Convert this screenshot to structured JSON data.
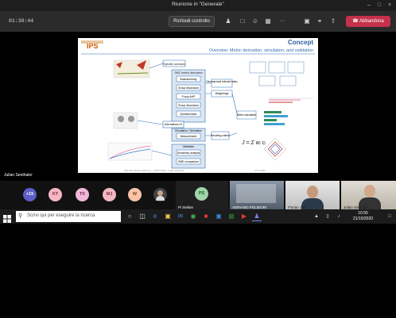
{
  "window": {
    "title": "Riunione in \"Generale\""
  },
  "toolbar": {
    "timer": "01:30:44",
    "request_control": "Richiedi controllo",
    "more": "···",
    "leave": "Abbandona"
  },
  "slide": {
    "logo": "IPS",
    "title": "Concept",
    "subtitle": "Overview: Metric derivation, simulation, and validation",
    "boxes": {
      "specific": "Specific scenario",
      "smc": "SMC metric derivation",
      "brainstorming": "Brainstorming",
      "group_discussion": "Group discussion",
      "fuzzy_ahp": "Fuzzy AHP",
      "group_discussion2": "Group discussion",
      "questionnaire": "Questionnaire",
      "decomposed": "Decomposed relevant tasks",
      "weightings": "Weightings",
      "metric_calc": "Metric calculation",
      "alternatives": "Alternatives IO",
      "simulation": "Simulation / Derivation",
      "measurement": "Measurement",
      "resulting": "Resulting criteria",
      "validation": "Validation",
      "sensitivity": "Sensitivity analysis",
      "sme_comparison": "SME comparison"
    },
    "formula": "J = Σ wᵢ cᵢ",
    "footer_left": "Multi-filer Mission Efficiency – AMIS4 2020 – Julian Seethaler",
    "footer_right": "07.11.2020"
  },
  "presenter": "Julian Seethaler",
  "participants": {
    "more": "+15",
    "avatars": [
      {
        "initials": "KT",
        "color": "#f4b6c2",
        "text": "#7a2e3f"
      },
      {
        "initials": "TK",
        "color": "#f0b8d8",
        "text": "#7a2e5c"
      },
      {
        "initials": "MJ",
        "color": "#f4b6c2",
        "text": "#7a2e3f"
      },
      {
        "initials": "W",
        "color": "#f9c3a8",
        "text": "#7a3e1c"
      }
    ],
    "ps": {
      "initials": "PS",
      "color": "#9fd5a8",
      "text": "#1d5a2a",
      "name": "Pi Stelian"
    },
    "tiles": [
      {
        "name": "ADRIANO POLIDORI"
      },
      {
        "name": "Florian Jae"
      },
      {
        "name": "Julian Seethaler"
      }
    ]
  },
  "taskbar": {
    "search_placeholder": "Scrivi qui per eseguire la ricerca",
    "time": "10:55",
    "date": "21/10/2020"
  },
  "colors": {
    "accent": "#c4314b",
    "box_blue": "#2f6fb0",
    "box_fill": "#dbe6f4"
  }
}
